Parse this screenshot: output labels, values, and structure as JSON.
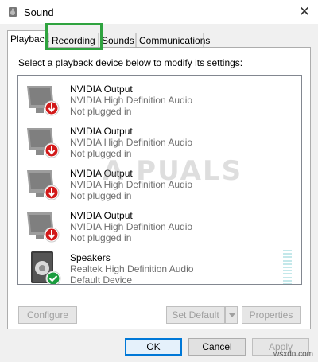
{
  "window": {
    "title": "Sound"
  },
  "tabs": [
    {
      "label": "Playback",
      "active": true
    },
    {
      "label": "Recording",
      "active": false
    },
    {
      "label": "Sounds",
      "active": false
    },
    {
      "label": "Communications",
      "active": false
    }
  ],
  "instruction": "Select a playback device below to modify its settings:",
  "devices": [
    {
      "name": "NVIDIA Output",
      "description": "NVIDIA High Definition Audio",
      "status": "Not plugged in",
      "icon": "monitor-icon",
      "badge": "unplugged-red-arrow-icon"
    },
    {
      "name": "NVIDIA Output",
      "description": "NVIDIA High Definition Audio",
      "status": "Not plugged in",
      "icon": "monitor-icon",
      "badge": "unplugged-red-arrow-icon"
    },
    {
      "name": "NVIDIA Output",
      "description": "NVIDIA High Definition Audio",
      "status": "Not plugged in",
      "icon": "monitor-icon",
      "badge": "unplugged-red-arrow-icon"
    },
    {
      "name": "NVIDIA Output",
      "description": "NVIDIA High Definition Audio",
      "status": "Not plugged in",
      "icon": "monitor-icon",
      "badge": "unplugged-red-arrow-icon"
    },
    {
      "name": "Speakers",
      "description": "Realtek High Definition Audio",
      "status": "Default Device",
      "icon": "speaker-icon",
      "badge": "default-green-check-icon"
    }
  ],
  "buttons": {
    "configure": "Configure",
    "set_default": "Set Default",
    "properties": "Properties",
    "ok": "OK",
    "cancel": "Cancel",
    "apply": "Apply"
  },
  "watermark": "A  PUALS",
  "site_tag": "wsxdn.com",
  "colors": {
    "highlight": "#2fa33f",
    "unplugged": "#d21a1a",
    "default": "#1a9c3e",
    "meter": "#c4e8ea"
  }
}
